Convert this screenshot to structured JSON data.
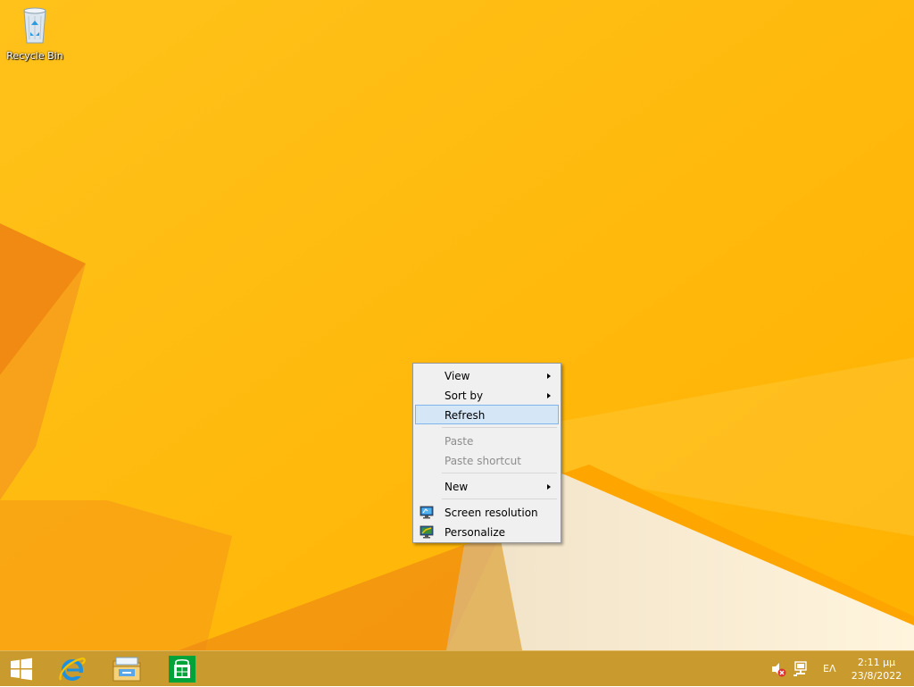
{
  "desktop": {
    "icons": [
      {
        "label": "Recycle Bin",
        "icon": "recycle-bin-icon"
      }
    ]
  },
  "context_menu": {
    "items": [
      {
        "label": "View",
        "submenu": true
      },
      {
        "label": "Sort by",
        "submenu": true
      },
      {
        "label": "Refresh",
        "highlighted": true
      },
      {
        "label": "Paste",
        "disabled": true
      },
      {
        "label": "Paste shortcut",
        "disabled": true
      },
      {
        "label": "New",
        "submenu": true
      },
      {
        "label": "Screen resolution",
        "icon": "screen-resolution-icon"
      },
      {
        "label": "Personalize",
        "icon": "personalize-icon"
      }
    ]
  },
  "taskbar": {
    "pinned": [
      {
        "icon": "start-icon"
      },
      {
        "icon": "internet-explorer-icon"
      },
      {
        "icon": "file-explorer-icon"
      },
      {
        "icon": "store-icon"
      }
    ],
    "tray": {
      "volume_icon": "volume-muted-icon",
      "network_icon": "network-icon",
      "language": "ΕΛ",
      "time": "2:11 μμ",
      "date": "23/8/2022"
    }
  },
  "colors": {
    "wallpaper": "#ffba0a",
    "menu_highlight": "#d5e6f7",
    "menu_highlight_border": "#7eb4ea",
    "taskbar": "#c99a2e"
  }
}
